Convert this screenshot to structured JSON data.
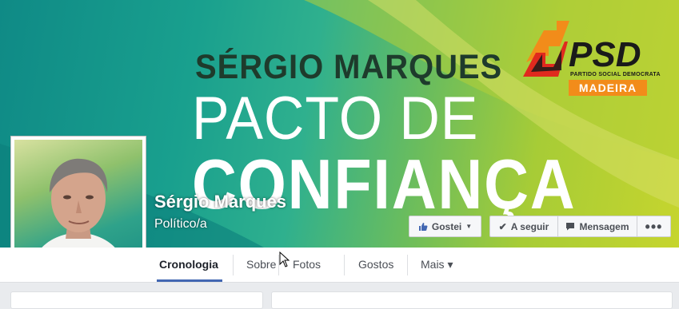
{
  "cover": {
    "name": "SÉRGIO MARQUES",
    "line1": "PACTO DE",
    "line2": "CONFIANÇA"
  },
  "logo": {
    "word": "PSD",
    "subtitle": "PARTIDO SOCIAL DEMOCRATA",
    "region": "MADEIRA"
  },
  "page": {
    "name": "Sérgio Marques",
    "category": "Político/a"
  },
  "actions": {
    "like": "Gostei",
    "follow": "A seguir",
    "message": "Mensagem",
    "more": "•••"
  },
  "tabs": [
    {
      "label": "Cronologia"
    },
    {
      "label": "Sobre"
    },
    {
      "label": "Fotos"
    },
    {
      "label": "Gostos"
    },
    {
      "label": "Mais ▾"
    }
  ],
  "colors": {
    "accent": "#4267b2",
    "psd_orange": "#f28c1a"
  }
}
